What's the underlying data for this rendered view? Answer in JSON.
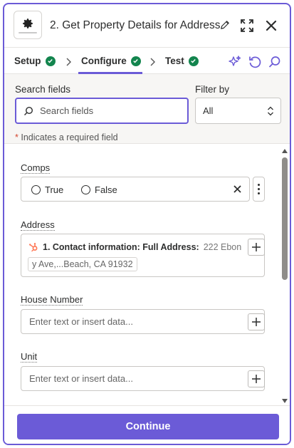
{
  "header": {
    "title": "2. Get Property Details for Address",
    "logo_icon": "gear-logo-icon",
    "edit_icon": "pencil-icon",
    "expand_icon": "expand-icon",
    "close_icon": "close-icon"
  },
  "tabs": {
    "items": [
      {
        "label": "Setup",
        "complete": true
      },
      {
        "label": "Configure",
        "complete": true,
        "active": true
      },
      {
        "label": "Test",
        "complete": true
      }
    ],
    "actions": [
      "ai-sparkle-icon",
      "refresh-icon",
      "search-icon"
    ]
  },
  "search": {
    "label": "Search fields",
    "placeholder": "Search fields",
    "filter_label": "Filter by",
    "filter_value": "All",
    "required_star": "*",
    "required_note": "Indicates a required field"
  },
  "fields": {
    "comps": {
      "label": "Comps",
      "options": [
        "True",
        "False"
      ]
    },
    "address": {
      "label": "Address",
      "source_icon": "hubspot-icon",
      "step_label": "1. Contact information: Full Address:",
      "value_head": "222 Ebon",
      "value_tail": "y Ave,...Beach, CA 91932"
    },
    "house_number": {
      "label": "House Number",
      "placeholder": "Enter text or insert data..."
    },
    "unit": {
      "label": "Unit",
      "placeholder": "Enter text or insert data..."
    }
  },
  "footer": {
    "continue_label": "Continue"
  },
  "colors": {
    "accent": "#6b5bd7",
    "success": "#13854e",
    "hubspot": "#ff7a59",
    "required": "#d4462f"
  }
}
